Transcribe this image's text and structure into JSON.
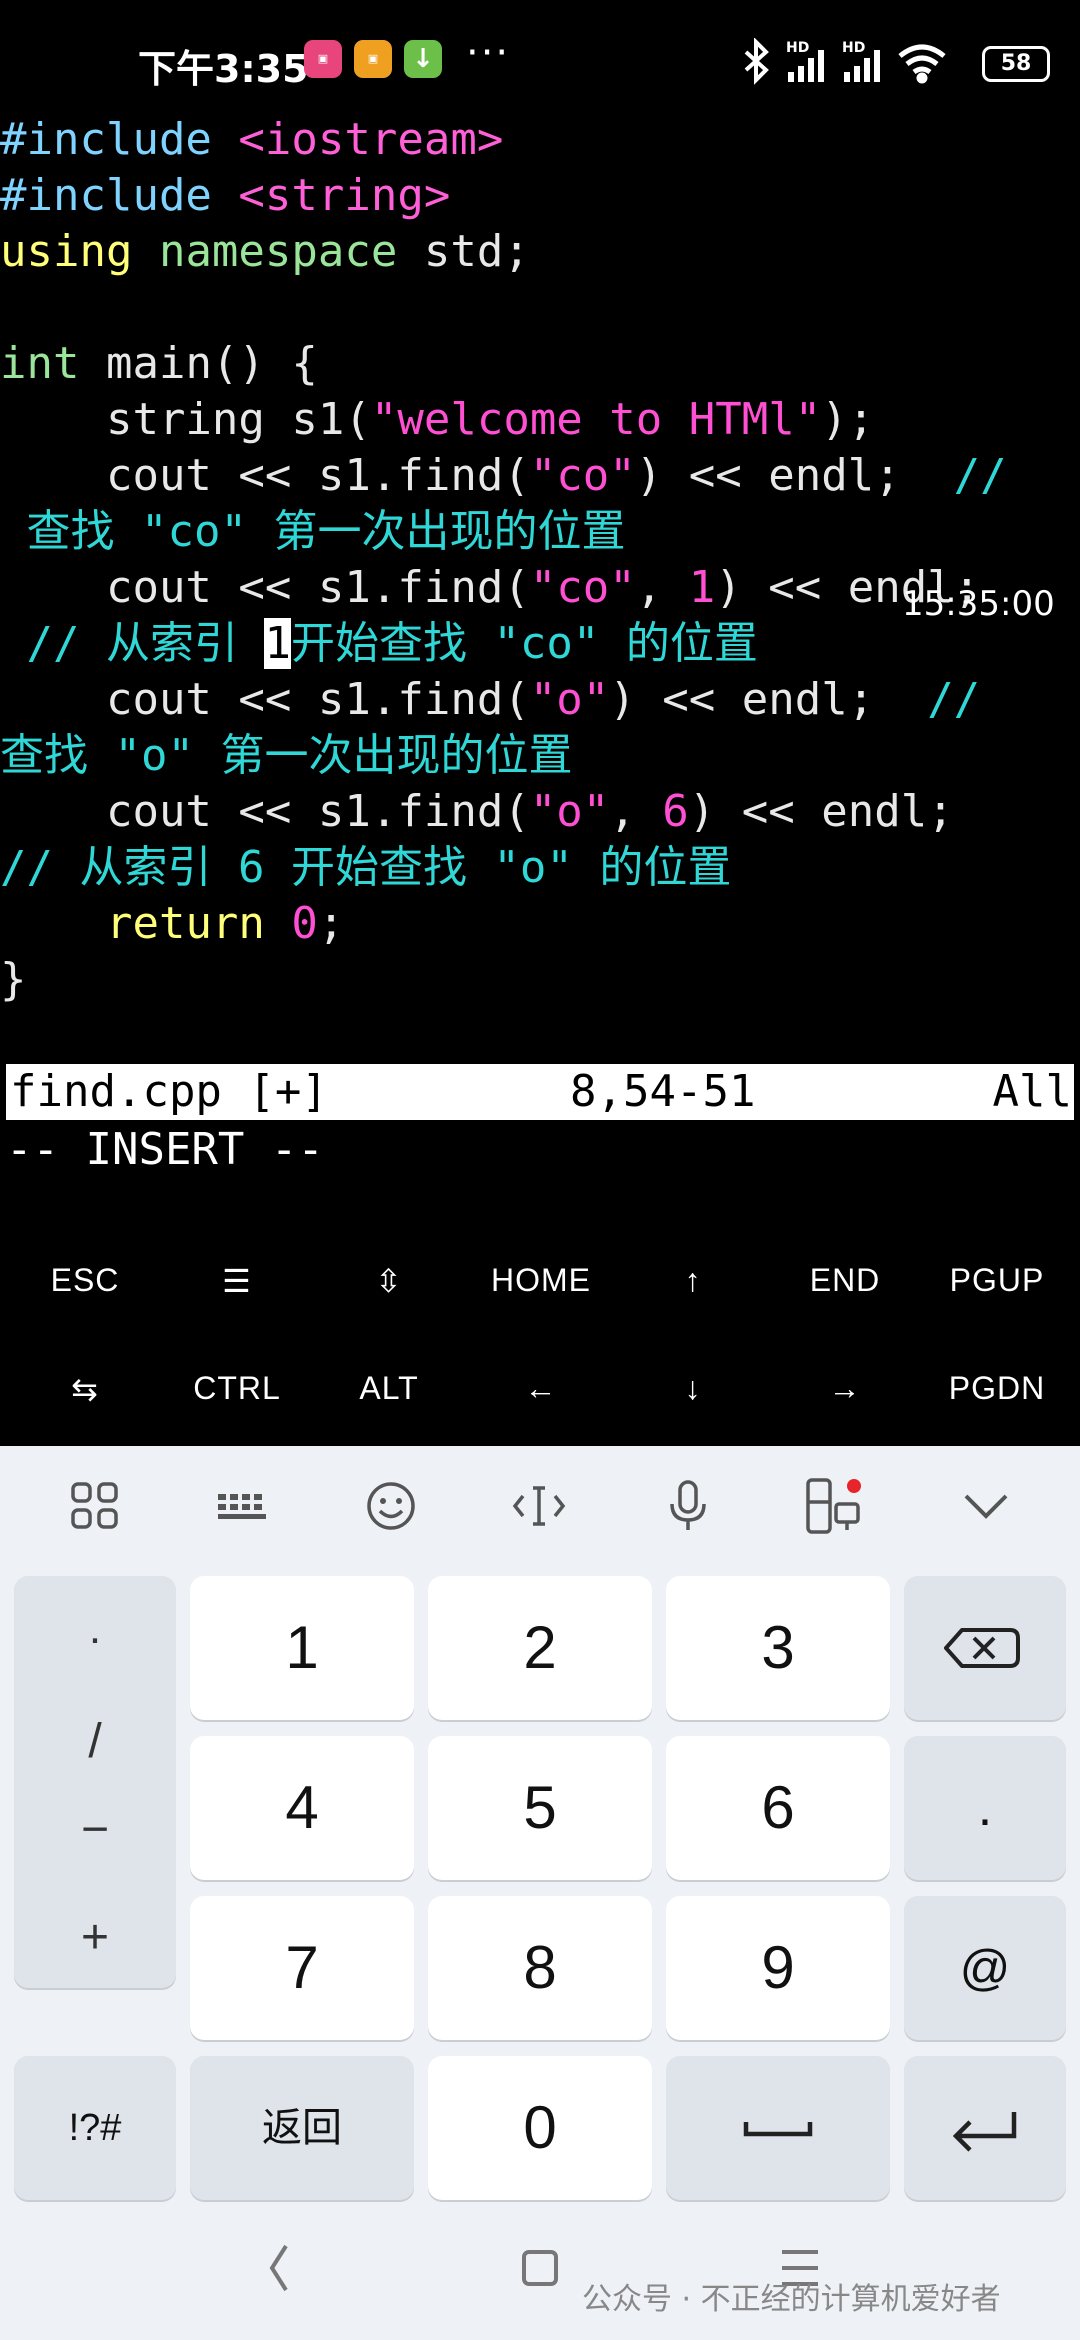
{
  "status_bar": {
    "time": "下午3:35",
    "more": "···",
    "signal_1": "HD",
    "signal_2": "HD",
    "battery": "58"
  },
  "code_lines": [
    {
      "segments": [
        {
          "t": "#include ",
          "c": "pp"
        },
        {
          "t": "<iostream>",
          "c": "inc"
        }
      ]
    },
    {
      "segments": [
        {
          "t": "#include ",
          "c": "pp"
        },
        {
          "t": "<string>",
          "c": "inc"
        }
      ]
    },
    {
      "segments": [
        {
          "t": "using",
          "c": "kw"
        },
        {
          "t": " ",
          "c": ""
        },
        {
          "t": "namespace",
          "c": "kw2"
        },
        {
          "t": " std;",
          "c": ""
        }
      ]
    },
    {
      "segments": [
        {
          "t": "",
          "c": ""
        }
      ]
    },
    {
      "segments": [
        {
          "t": "int",
          "c": "kw2"
        },
        {
          "t": " main() {",
          "c": ""
        }
      ]
    },
    {
      "segments": [
        {
          "t": "    string s1(",
          "c": ""
        },
        {
          "t": "\"welcome to HTMl\"",
          "c": "str"
        },
        {
          "t": ");",
          "c": ""
        }
      ]
    },
    {
      "segments": [
        {
          "t": "    cout << s1.find(",
          "c": ""
        },
        {
          "t": "\"co\"",
          "c": "str"
        },
        {
          "t": ") << endl;  ",
          "c": ""
        },
        {
          "t": "//",
          "c": "cm"
        }
      ]
    },
    {
      "segments": [
        {
          "t": " 查找 ",
          "c": "cm"
        },
        {
          "t": "\"co\"",
          "c": "cm"
        },
        {
          "t": " 第一次出现的位置",
          "c": "cm"
        }
      ]
    },
    {
      "segments": [
        {
          "t": "    cout << s1.find(",
          "c": ""
        },
        {
          "t": "\"co\"",
          "c": "str"
        },
        {
          "t": ", ",
          "c": ""
        },
        {
          "t": "1",
          "c": "num"
        },
        {
          "t": ") << endl;",
          "c": ""
        }
      ]
    },
    {
      "segments": [
        {
          "t": " // 从索引 ",
          "c": "cm"
        },
        {
          "t": "1",
          "c": "cursor"
        },
        {
          "t": "开始查找 \"co\" 的位置",
          "c": "cm"
        }
      ]
    },
    {
      "segments": [
        {
          "t": "    cout << s1.find(",
          "c": ""
        },
        {
          "t": "\"o\"",
          "c": "str"
        },
        {
          "t": ") << endl;  ",
          "c": ""
        },
        {
          "t": "//",
          "c": "cm"
        }
      ]
    },
    {
      "segments": [
        {
          "t": "查找 \"o\" 第一次出现的位置",
          "c": "cm"
        }
      ]
    },
    {
      "segments": [
        {
          "t": "    cout << s1.find(",
          "c": ""
        },
        {
          "t": "\"o\"",
          "c": "str"
        },
        {
          "t": ", ",
          "c": ""
        },
        {
          "t": "6",
          "c": "num"
        },
        {
          "t": ") << endl;",
          "c": ""
        }
      ]
    },
    {
      "segments": [
        {
          "t": "// 从索引 6 开始查找 \"o\" 的位置",
          "c": "cm"
        }
      ]
    },
    {
      "segments": [
        {
          "t": "    ",
          "c": ""
        },
        {
          "t": "return",
          "c": "kw"
        },
        {
          "t": " ",
          "c": ""
        },
        {
          "t": "0",
          "c": "num"
        },
        {
          "t": ";",
          "c": ""
        }
      ]
    },
    {
      "segments": [
        {
          "t": "}",
          "c": ""
        }
      ]
    }
  ],
  "time_stamp": "15:35:00",
  "vim": {
    "file": "find.cpp [+]",
    "position": "8,54-51",
    "scroll": "All",
    "mode": "-- INSERT --"
  },
  "extra_keys_row1": [
    "ESC",
    "☰",
    "⇳",
    "HOME",
    "↑",
    "END",
    "PGUP"
  ],
  "extra_keys_row2": [
    "⇆",
    "CTRL",
    "ALT",
    "←",
    "↓",
    "→",
    "PGDN"
  ],
  "keyboard": {
    "toolbar_icons": [
      "apps-icon",
      "keyboard-icon",
      "emoji-icon",
      "cursor-icon",
      "mic-icon",
      "clipboard-device-icon",
      "collapse-icon"
    ],
    "symbols": [
      ".",
      "/",
      "−",
      "+"
    ],
    "digits": [
      "1",
      "2",
      "3",
      "4",
      "5",
      "6",
      "7",
      "8",
      "9"
    ],
    "dot_key": ".",
    "at_key": "@",
    "sym_key": "!?#",
    "back_key": "返回",
    "zero_key": "0"
  },
  "watermark": "公众号 · 不正经的计算机爱好者"
}
